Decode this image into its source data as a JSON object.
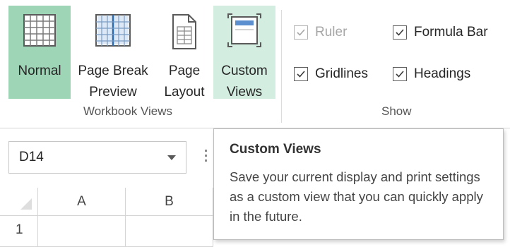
{
  "workbook_views": {
    "group_label": "Workbook Views",
    "buttons": [
      {
        "id": "normal",
        "label_line1": "Normal",
        "label_line2": "",
        "icon": "normal-view-icon",
        "state": "active"
      },
      {
        "id": "page_break",
        "label_line1": "Page Break",
        "label_line2": "Preview",
        "icon": "page-break-preview-icon",
        "state": "normal"
      },
      {
        "id": "page_layout",
        "label_line1": "Page",
        "label_line2": "Layout",
        "icon": "page-layout-icon",
        "state": "normal"
      },
      {
        "id": "custom_views",
        "label_line1": "Custom",
        "label_line2": "Views",
        "icon": "custom-views-icon",
        "state": "hover"
      }
    ]
  },
  "show": {
    "group_label": "Show",
    "checkboxes": [
      {
        "id": "ruler",
        "label": "Ruler",
        "checked": true,
        "disabled": true
      },
      {
        "id": "formula_bar",
        "label": "Formula Bar",
        "checked": true,
        "disabled": false
      },
      {
        "id": "gridlines",
        "label": "Gridlines",
        "checked": true,
        "disabled": false
      },
      {
        "id": "headings",
        "label": "Headings",
        "checked": true,
        "disabled": false
      }
    ]
  },
  "name_box": {
    "value": "D14"
  },
  "grid": {
    "columns": [
      "A",
      "B"
    ],
    "rows": [
      "1"
    ]
  },
  "tooltip": {
    "title": "Custom Views",
    "body": "Save your current display and print settings as a custom view that you can quickly apply in the future."
  },
  "colors": {
    "active_button": "#9fd5b7",
    "hover_button": "#d3ede0"
  }
}
